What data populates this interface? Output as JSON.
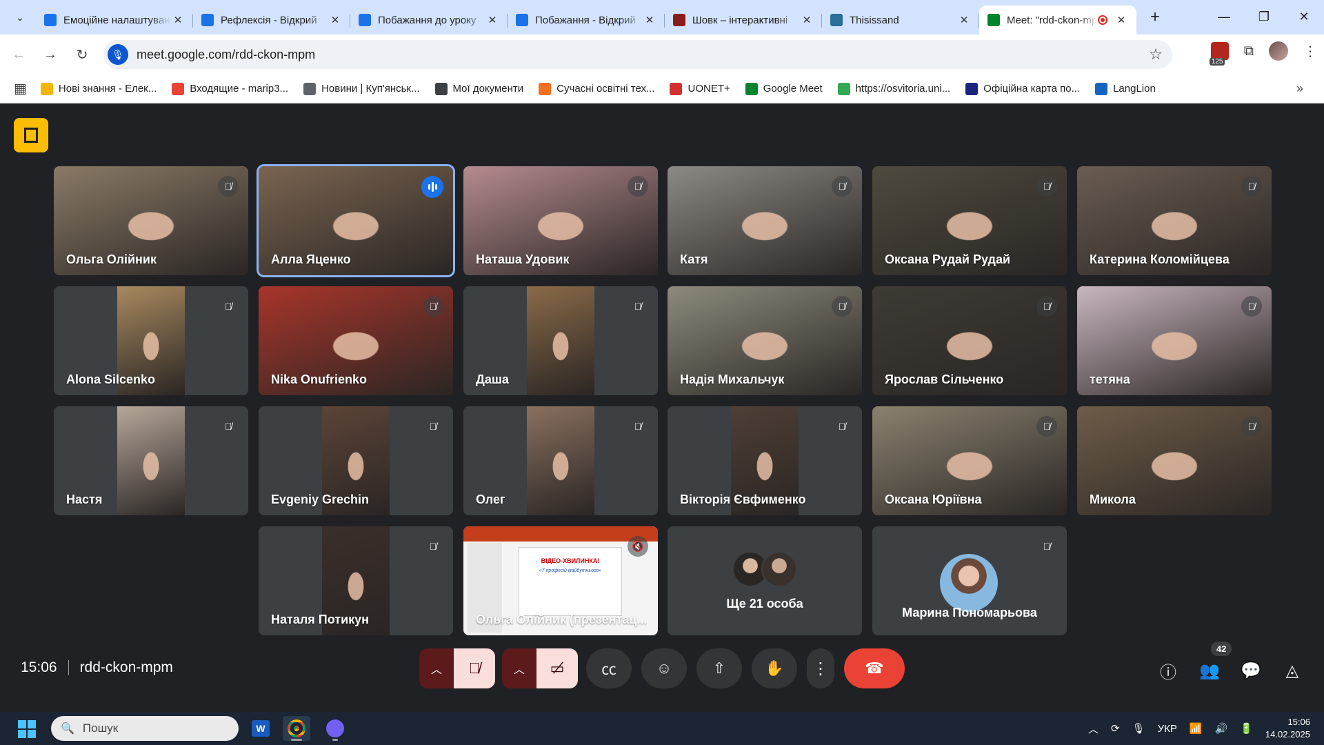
{
  "browser": {
    "tabs": [
      {
        "title": "Емоційне налаштування",
        "favicon_color": "#1a73e8"
      },
      {
        "title": "Рефлексія - Відкрий",
        "favicon_color": "#1a73e8"
      },
      {
        "title": "Побажання до уроку",
        "favicon_color": "#1a73e8"
      },
      {
        "title": "Побажання - Відкрий",
        "favicon_color": "#1a73e8"
      },
      {
        "title": "Шовк – інтерактивні",
        "favicon_color": "#8b1a1a"
      },
      {
        "title": "Thisissand",
        "favicon_color": "#2a6f97"
      },
      {
        "title": "Meet: \"rdd-ckon-mpm\"",
        "favicon_color": "#00832d",
        "active": true,
        "recording": true
      }
    ],
    "url": "meet.google.com/rdd-ckon-mpm",
    "extension_badge": "125",
    "bookmarks": [
      {
        "label": "Нові знання - Елек...",
        "icon_color": "#f4b400"
      },
      {
        "label": "Входящие - marip3...",
        "icon_color": "#ea4335"
      },
      {
        "label": "Новини | Куп'янськ...",
        "icon_color": "#5f6368"
      },
      {
        "label": "Мої документи",
        "icon_color": "#3c4043"
      },
      {
        "label": "Сучасні освітні тех...",
        "icon_color": "#f36f21"
      },
      {
        "label": "UONET+",
        "icon_color": "#d32f2f"
      },
      {
        "label": "Google Meet",
        "icon_color": "#00832d"
      },
      {
        "label": "https://osvitoria.uni...",
        "icon_color": "#34a853"
      },
      {
        "label": "Офіційна карта по...",
        "icon_color": "#1a237e"
      },
      {
        "label": "LangLion",
        "icon_color": "#1565c0"
      }
    ]
  },
  "meet": {
    "participants": [
      {
        "name": "Ольга Олійник",
        "bg": "#8a7a66",
        "muted": true
      },
      {
        "name": "Алла Яценко",
        "bg": "#7a6450",
        "speaking": true
      },
      {
        "name": "Наташа Удовик",
        "bg": "#b58b8f",
        "muted": true
      },
      {
        "name": "Катя",
        "bg": "#8c8a84",
        "muted": true
      },
      {
        "name": "Оксана Рудай Рудай",
        "bg": "#4e4a3e",
        "muted": true
      },
      {
        "name": "Катерина Коломійцева",
        "bg": "#6a5c52",
        "muted": true
      },
      {
        "name": "Alona Silcenko",
        "bg": "#a8895f",
        "muted": true,
        "narrow": true
      },
      {
        "name": "Nika Onufrienko",
        "bg": "#a8352a",
        "muted": true
      },
      {
        "name": "Даша",
        "bg": "#8a6a48",
        "muted": true,
        "narrow": true
      },
      {
        "name": "Надія Михальчук",
        "bg": "#8d8a7c",
        "muted": true
      },
      {
        "name": "Ярослав Сільченко",
        "bg": "#3e3a34",
        "muted": true
      },
      {
        "name": "тетяна",
        "bg": "#c9b6c0",
        "muted": true
      },
      {
        "name": "Настя",
        "bg": "#b7a79a",
        "muted": true,
        "narrow": true
      },
      {
        "name": "Evgeniy Grechin",
        "bg": "#5c4438",
        "muted": true,
        "narrow": true
      },
      {
        "name": "Олег",
        "bg": "#8a7060",
        "muted": true,
        "narrow": true
      },
      {
        "name": "Вікторія Євфименко",
        "bg": "#4f3f36",
        "muted": true,
        "narrow": true
      },
      {
        "name": "Оксана Юріївна",
        "bg": "#8a8270",
        "muted": true
      },
      {
        "name": "Микола",
        "bg": "#6e5c48",
        "muted": true
      },
      {
        "name": "Наталя Потикун",
        "bg": "#3a2f2a",
        "muted": true,
        "narrow": true
      }
    ],
    "presentation": {
      "label": "Ольга Олійник (презентац...",
      "slide_title": "ВІДЕО-ХВИЛИНКА!",
      "slide_subtitle": "«7 професій майбутнього»"
    },
    "more_people_label": "Ще 21 особа",
    "avatar_tile_name": "Марина Пономарьова",
    "time": "15:06",
    "meeting_code": "rdd-ckon-mpm",
    "people_count": "42"
  },
  "taskbar": {
    "search_placeholder": "Пошук",
    "language": "УКР",
    "clock_time": "15:06",
    "clock_date": "14.02.2025"
  }
}
